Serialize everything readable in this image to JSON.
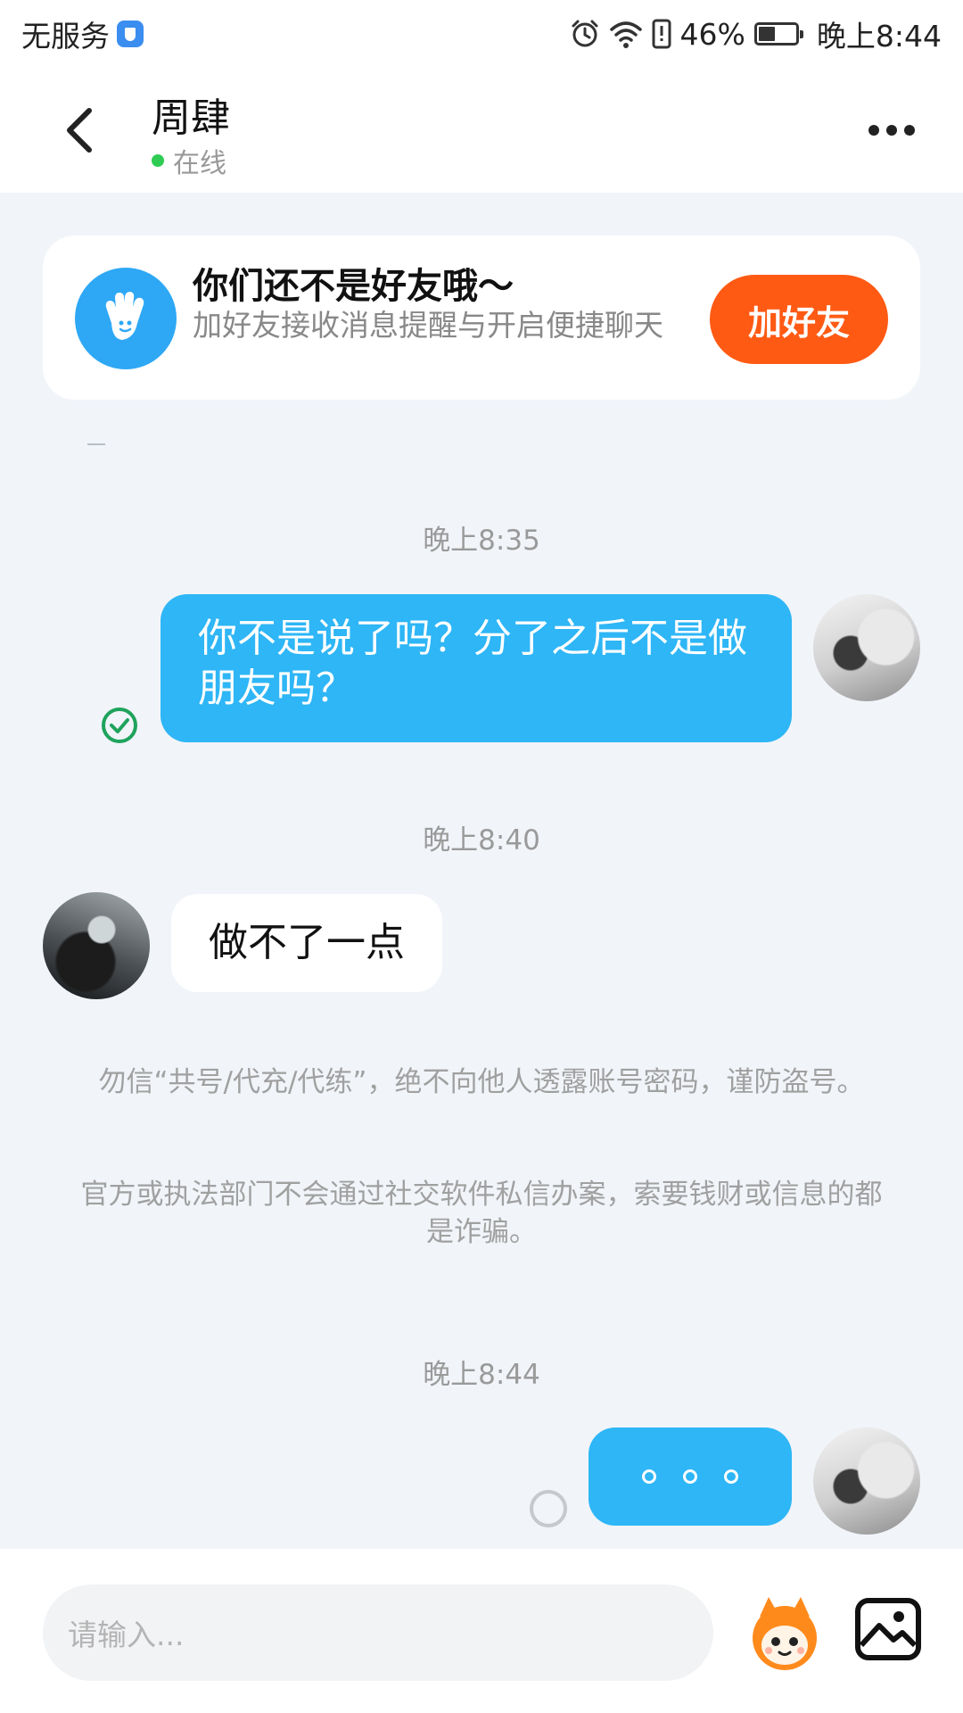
{
  "status_bar": {
    "carrier": "无服务",
    "battery": "46%",
    "time": "晚上8:44"
  },
  "header": {
    "name": "周肆",
    "presence": "在线"
  },
  "friend_card": {
    "title": "你们还不是好友哦～",
    "subtitle": "加好友接收消息提醒与开启便捷聊天",
    "button": "加好友"
  },
  "messages": [
    {
      "time": "晚上8:35",
      "direction": "out",
      "text": "你不是说了吗？分了之后不是做朋友吗？",
      "status": "read"
    },
    {
      "time": "晚上8:40",
      "direction": "in",
      "text": "做不了一点"
    },
    {
      "time": "晚上8:44",
      "direction": "out",
      "text": "。。。",
      "status": "sending"
    }
  ],
  "notices": [
    "勿信“共号/代充/代练”，绝不向他人透露账号密码，谨防盗号。",
    "官方或执法部门不会通过社交软件私信办案，索要钱财或信息的都是诈骗。"
  ],
  "input": {
    "placeholder": "请输入..."
  },
  "icons": {
    "back": "chevron-left-icon",
    "more": "more-dots-icon",
    "wave": "waving-hand-icon",
    "emoji": "mascot-emoji-icon",
    "image": "image-icon",
    "read": "check-circle-icon"
  },
  "colors": {
    "accent_blue": "#2eb6f6",
    "add_button": "#ff5a14",
    "online": "#2ecc54",
    "background": "#f1f4f9"
  }
}
